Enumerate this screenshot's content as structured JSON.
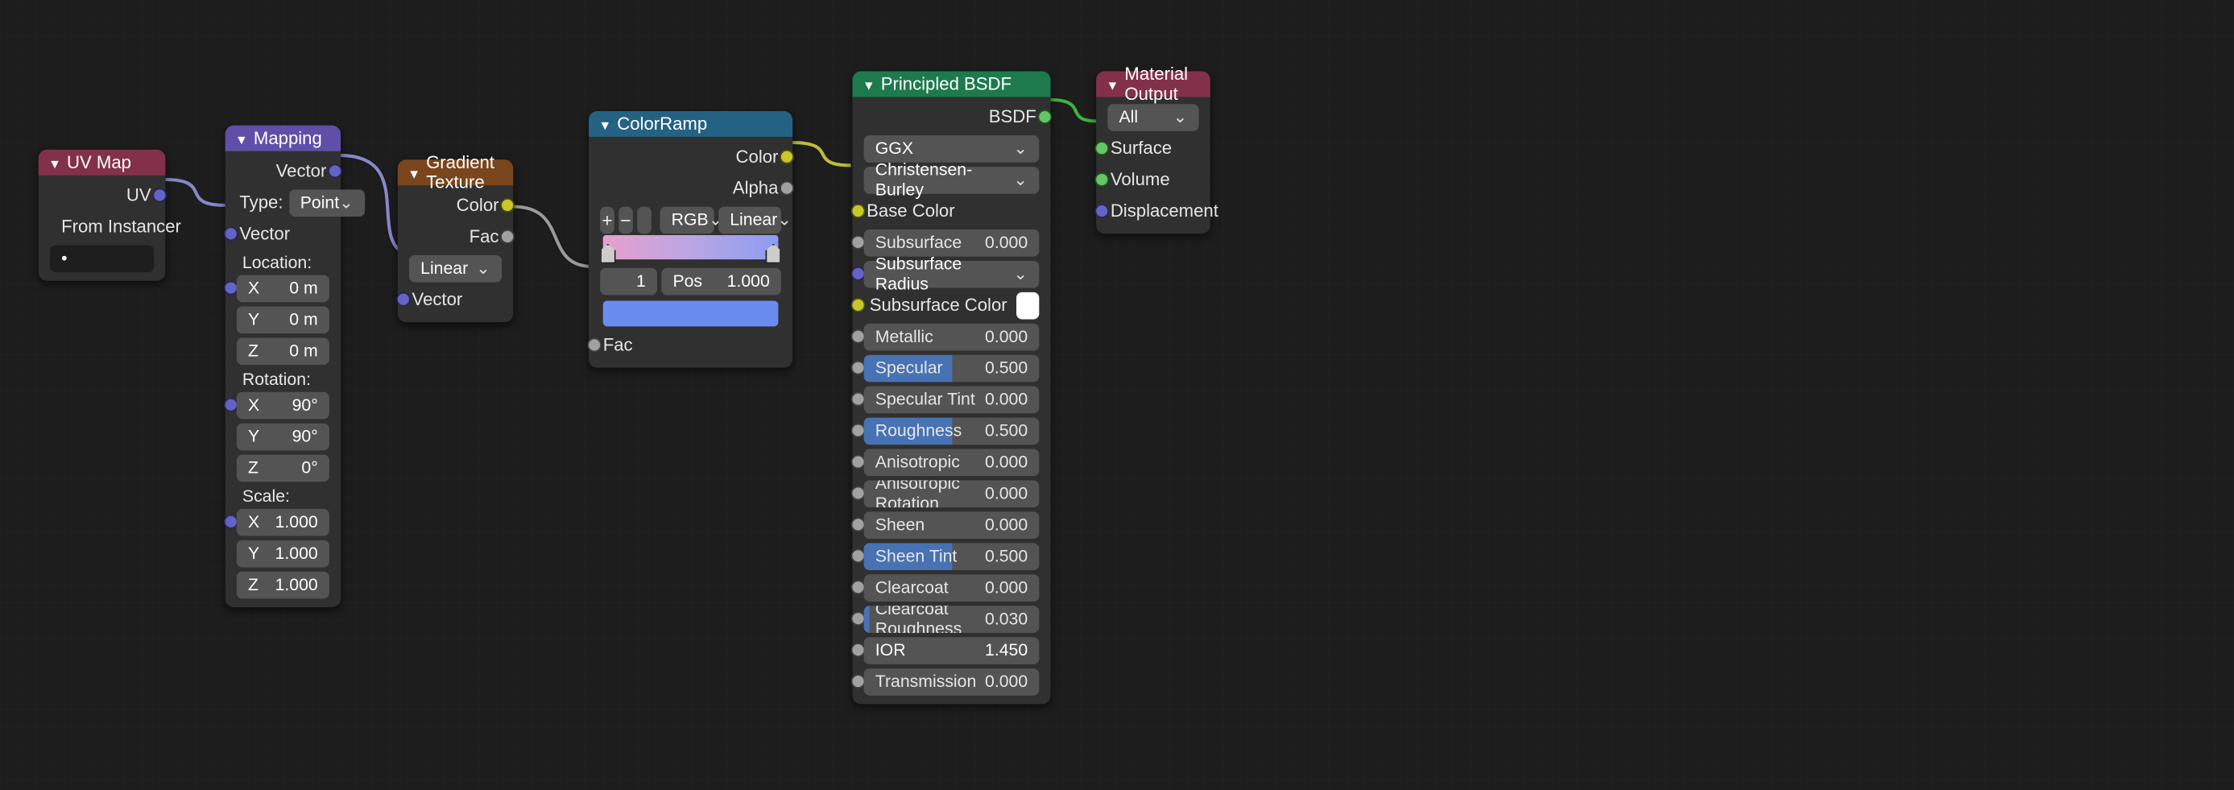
{
  "uvmap": {
    "title": "UV Map",
    "out_uv": "UV",
    "from_instancer": "From Instancer",
    "map_value": "•"
  },
  "mapping": {
    "title": "Mapping",
    "out_vector": "Vector",
    "type_label": "Type:",
    "type_value": "Point",
    "in_vector": "Vector",
    "location_label": "Location:",
    "loc_x": {
      "k": "X",
      "v": "0 m"
    },
    "loc_y": {
      "k": "Y",
      "v": "0 m"
    },
    "loc_z": {
      "k": "Z",
      "v": "0 m"
    },
    "rotation_label": "Rotation:",
    "rot_x": {
      "k": "X",
      "v": "90°"
    },
    "rot_y": {
      "k": "Y",
      "v": "90°"
    },
    "rot_z": {
      "k": "Z",
      "v": "0°"
    },
    "scale_label": "Scale:",
    "scl_x": {
      "k": "X",
      "v": "1.000"
    },
    "scl_y": {
      "k": "Y",
      "v": "1.000"
    },
    "scl_z": {
      "k": "Z",
      "v": "1.000"
    }
  },
  "gradient": {
    "title": "Gradient Texture",
    "out_color": "Color",
    "out_fac": "Fac",
    "mode": "Linear",
    "in_vector": "Vector"
  },
  "colorramp": {
    "title": "ColorRamp",
    "out_color": "Color",
    "out_alpha": "Alpha",
    "btn_add": "+",
    "btn_remove": "−",
    "mode_color": "RGB",
    "mode_interp": "Linear",
    "active_index": "1",
    "pos_label": "Pos",
    "pos_value": "1.000",
    "in_fac": "Fac"
  },
  "bsdf": {
    "title": "Principled BSDF",
    "out_bsdf": "BSDF",
    "distribution": "GGX",
    "sss_method": "Christensen-Burley",
    "base_color": "Base Color",
    "subsurface": {
      "label": "Subsurface",
      "value": "0.000",
      "fill": 0
    },
    "subsurface_radius": "Subsurface Radius",
    "subsurface_color": "Subsurface Color",
    "metallic": {
      "label": "Metallic",
      "value": "0.000",
      "fill": 0
    },
    "specular": {
      "label": "Specular",
      "value": "0.500",
      "fill": 0.5
    },
    "specular_tint": {
      "label": "Specular Tint",
      "value": "0.000",
      "fill": 0
    },
    "roughness": {
      "label": "Roughness",
      "value": "0.500",
      "fill": 0.5
    },
    "anisotropic": {
      "label": "Anisotropic",
      "value": "0.000",
      "fill": 0
    },
    "anisotropic_rotation": {
      "label": "Anisotropic Rotation",
      "value": "0.000",
      "fill": 0
    },
    "sheen": {
      "label": "Sheen",
      "value": "0.000",
      "fill": 0
    },
    "sheen_tint": {
      "label": "Sheen Tint",
      "value": "0.500",
      "fill": 0.5
    },
    "clearcoat": {
      "label": "Clearcoat",
      "value": "0.000",
      "fill": 0
    },
    "clearcoat_roughness": {
      "label": "Clearcoat Roughness",
      "value": "0.030",
      "fill": 0.03
    },
    "ior": {
      "label": "IOR",
      "value": "1.450"
    },
    "transmission": {
      "label": "Transmission",
      "value": "0.000",
      "fill": 0
    }
  },
  "output": {
    "title": "Material Output",
    "target": "All",
    "in_surface": "Surface",
    "in_volume": "Volume",
    "in_displacement": "Displacement"
  }
}
